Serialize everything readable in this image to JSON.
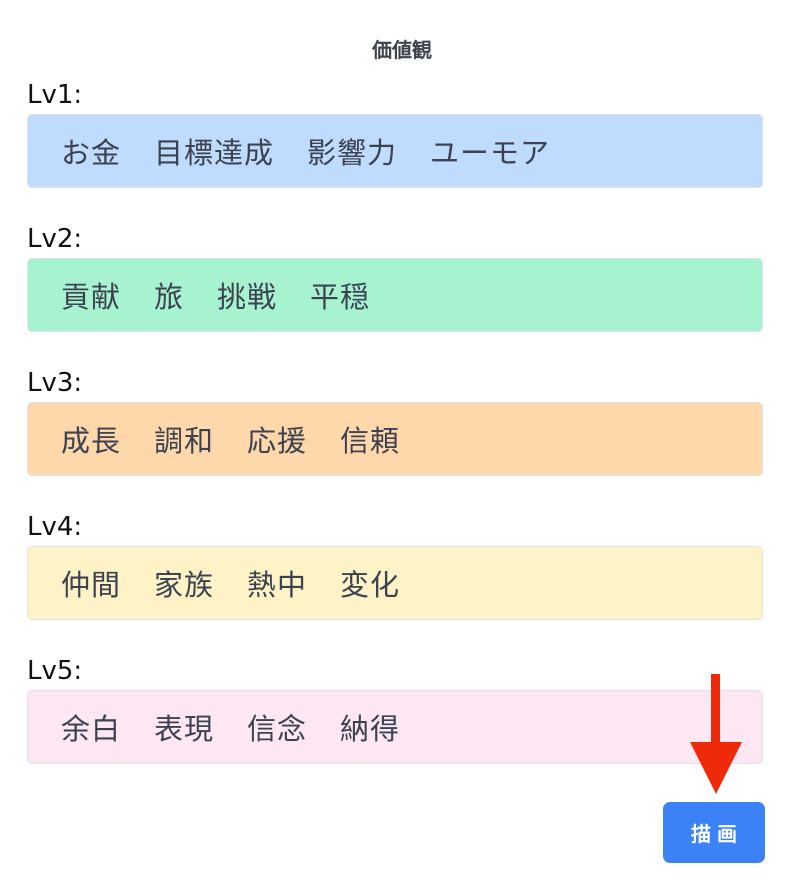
{
  "title": "価値観",
  "levels": [
    {
      "label": "Lv1:",
      "color": "#bfdbfe",
      "items": [
        "お金",
        "目標達成",
        "影響力",
        "ユーモア"
      ]
    },
    {
      "label": "Lv2:",
      "color": "#a7f3d0",
      "items": [
        "貢献",
        "旅",
        "挑戦",
        "平穏"
      ]
    },
    {
      "label": "Lv3:",
      "color": "#fed7aa",
      "items": [
        "成長",
        "調和",
        "応援",
        "信頼"
      ]
    },
    {
      "label": "Lv4:",
      "color": "#fef3c7",
      "items": [
        "仲間",
        "家族",
        "熱中",
        "変化"
      ]
    },
    {
      "label": "Lv5:",
      "color": "#fce7f3",
      "items": [
        "余白",
        "表現",
        "信念",
        "納得"
      ]
    }
  ],
  "draw_button": {
    "label": "描画",
    "color": "#3b82f6"
  },
  "annotation_arrow": {
    "color": "#ef2a0a"
  }
}
